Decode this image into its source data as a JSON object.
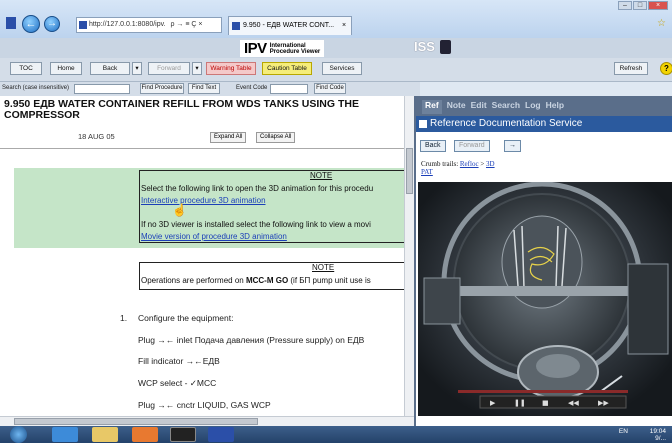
{
  "browser": {
    "address": "http://127.0.0.1:8080/ipv.",
    "address_suffix": "ρ → ≡ Ç ×",
    "tab_title": "9.950 - ЕДВ WATER CONT...",
    "tab_close": "×",
    "back_icon": "back-arrow-icon",
    "forward_icon": "forward-arrow-icon"
  },
  "header": {
    "ipv": "IPV",
    "ipv_sub1": "International",
    "ipv_sub2": "Procedure Viewer",
    "iss": "ISS"
  },
  "toolbar": {
    "toc": "TOC",
    "home": "Home",
    "back": "Back",
    "forward": "Forward",
    "warning": "Warning Table",
    "caution": "Caution Table",
    "services": "Services",
    "refresh": "Refresh",
    "help": "?"
  },
  "search": {
    "label": "Search (case insensitive)",
    "find_procedure": "Find Procedure",
    "find_text": "Find Text",
    "event_code_label": "Event Code",
    "find_code": "Find Code"
  },
  "procedure": {
    "title": "9.950 ЕДВ WATER CONTAINER REFILL FROM WDS TANKS USING THE COMPRESSOR",
    "date": "18 AUG 05",
    "expand_all": "Expand All",
    "collapse_all": "Collapse All",
    "note1_title": "NOTE",
    "note1_text": "Select the following link to open the 3D animation for this procedu",
    "note1_link": "Interactive procedure 3D animation",
    "note1_text2": "If no 3D viewer is installed select the following link to view a movi",
    "note1_link2": "Movie version of procedure 3D animation",
    "note2_title": "NOTE",
    "note2_text_a": "Operations are performed on ",
    "note2_text_b": "MCC-M GO",
    "note2_text_c": " (if БП pump unit use is",
    "step_num": "1.",
    "step_title": "Configure the equipment:",
    "step_lines": [
      "Plug →← inlet Подача давления (Pressure supply) on ЕДВ",
      "Fill indicator →←ЕДВ",
      "WCP select - ✓MCC",
      "Plug →← cnctr LIQUID, GAS WCP"
    ]
  },
  "ref": {
    "tabs": [
      "Ref",
      "Note",
      "Edit",
      "Search",
      "Log",
      "Help"
    ],
    "title": "Reference Documentation Service",
    "back": "Back",
    "forward": "Forward",
    "go": "→",
    "crumb_label": "Crumb trails: ",
    "crumb_refloc": "Refloc",
    "crumb_sep": " > ",
    "crumb_3d": "3D",
    "crumb_pat": "PAT"
  },
  "taskbar": {
    "lang": "EN",
    "time": "19:04",
    "date": "9/..."
  },
  "colors": {
    "note_green": "#c5e5c8",
    "link_blue": "#1b3fb8",
    "title_bar": "#2b5a9e",
    "warning": "#f4c9c9",
    "caution": "#f5ed7a"
  }
}
